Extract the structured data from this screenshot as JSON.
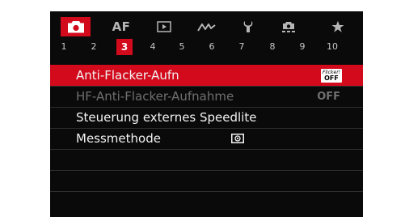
{
  "tabs": [
    {
      "name": "camera-icon",
      "active": true
    },
    {
      "name": "AF",
      "active": false
    },
    {
      "name": "playback-icon",
      "active": false
    },
    {
      "name": "wireless-icon",
      "active": false
    },
    {
      "name": "wrench-icon",
      "active": false
    },
    {
      "name": "custom-function-icon",
      "active": false
    },
    {
      "name": "star-icon",
      "active": false
    }
  ],
  "tab_af_label": "AF",
  "pages": [
    "1",
    "2",
    "3",
    "4",
    "5",
    "6",
    "7",
    "8",
    "9",
    "10"
  ],
  "active_page": "3",
  "menu": {
    "items": [
      {
        "label": "Anti-Flacker-Aufn",
        "badge_top": "Flicker!",
        "badge_bottom": "OFF"
      },
      {
        "label": "HF-Anti-Flacker-Aufnahme",
        "value": "OFF"
      },
      {
        "label": "Steuerung externes Speedlite"
      },
      {
        "label": "Messmethode",
        "icon": "evaluative-metering-icon"
      }
    ]
  },
  "colors": {
    "accent": "#d20a1c",
    "background": "#0a0a0a",
    "text": "#f2f2f2",
    "disabled_text": "#6f6f6f"
  }
}
